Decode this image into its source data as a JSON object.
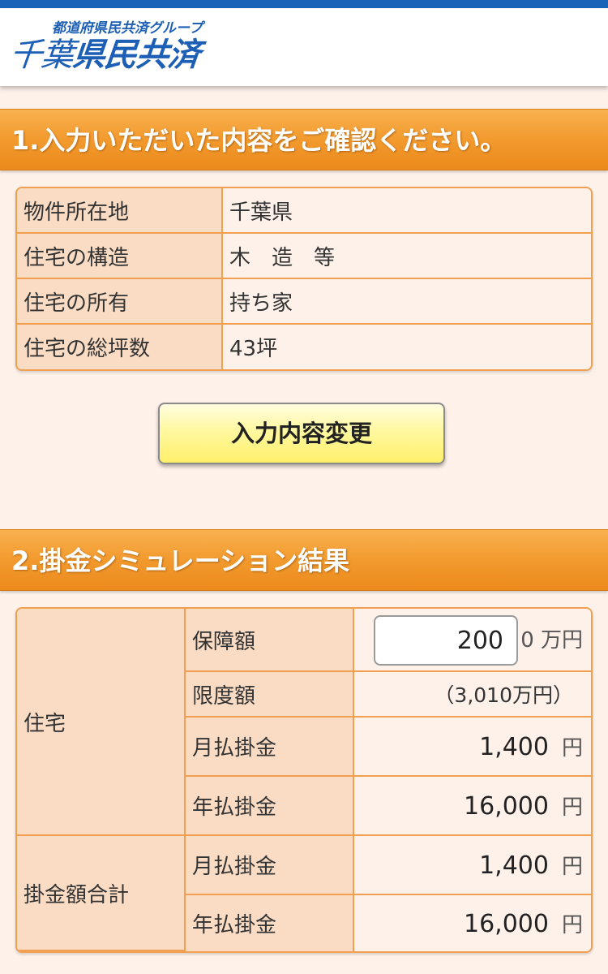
{
  "header": {
    "group_label": "都道府県民共済グループ",
    "brand_prefix": "千葉",
    "brand_suffix": "県民共済"
  },
  "section1": {
    "title": "1.入力いただいた内容をご確認ください。",
    "rows": [
      {
        "label": "物件所在地",
        "value": "千葉県"
      },
      {
        "label": "住宅の構造",
        "value": "木　造　等"
      },
      {
        "label": "住宅の所有",
        "value": "持ち家"
      },
      {
        "label": "住宅の総坪数",
        "value": "43坪"
      }
    ],
    "change_button": "入力内容変更"
  },
  "section2": {
    "title": "2.掛金シミュレーション結果",
    "housing": {
      "group_label": "住宅",
      "coverage_label": "保障額",
      "coverage_value": "200",
      "coverage_suffix": "0 万円",
      "limit_label": "限度額",
      "limit_value": "（3,010万円）",
      "monthly_label": "月払掛金",
      "monthly_value": "1,400",
      "yearly_label": "年払掛金",
      "yearly_value": "16,000",
      "unit": "円"
    },
    "total": {
      "group_label": "掛金額合計",
      "monthly_label": "月払掛金",
      "monthly_value": "1,400",
      "yearly_label": "年払掛金",
      "yearly_value": "16,000",
      "unit": "円"
    }
  },
  "colors": {
    "brand_blue": "#1c5fb5",
    "section_orange": "#f29a2e",
    "label_bg": "#fadcc4",
    "border_orange": "#f0a050",
    "button_yellow": "#fff8a0"
  }
}
